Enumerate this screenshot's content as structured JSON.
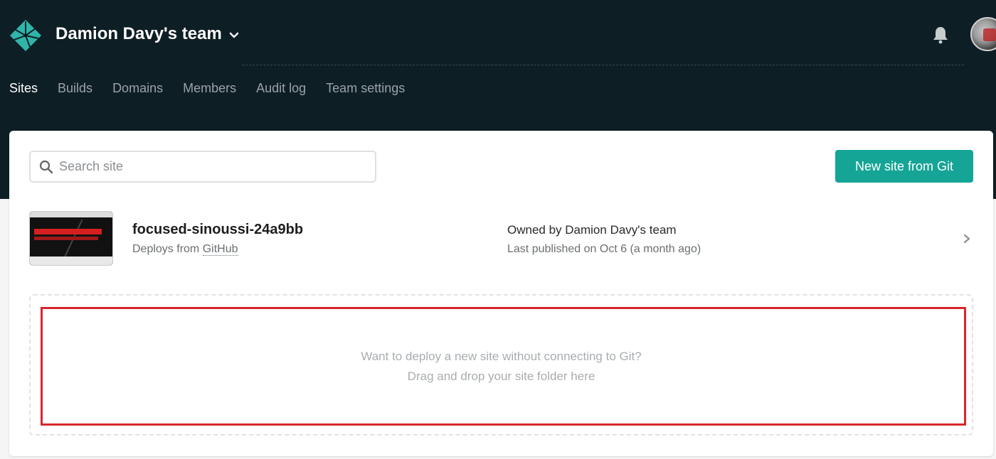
{
  "header": {
    "team_name": "Damion Davy's team",
    "icons": {
      "logo": "netlify-logo-icon",
      "team_chevron": "chevron-down-icon",
      "notifications": "bell-icon",
      "avatar": "user-avatar"
    }
  },
  "nav": {
    "tabs": [
      {
        "label": "Sites",
        "active": true
      },
      {
        "label": "Builds",
        "active": false
      },
      {
        "label": "Domains",
        "active": false
      },
      {
        "label": "Members",
        "active": false
      },
      {
        "label": "Audit log",
        "active": false
      },
      {
        "label": "Team settings",
        "active": false
      }
    ]
  },
  "search": {
    "placeholder": "Search site",
    "value": "",
    "icon": "search-icon"
  },
  "actions": {
    "new_site_label": "New site from Git"
  },
  "sites": [
    {
      "name": "focused-sinoussi-24a9bb",
      "deploys_prefix": "Deploys from ",
      "deploys_source": "GitHub",
      "owned_prefix": "Owned by ",
      "owner": "Damion Davy's team",
      "published": "Last published on Oct 6 (a month ago)"
    }
  ],
  "dropzone": {
    "line1": "Want to deploy a new site without connecting to Git?",
    "line2": "Drag and drop your site folder here"
  },
  "colors": {
    "header_bg": "#0e1e25",
    "accent": "#15a596",
    "highlight_border": "#d9262c",
    "page_bg": "#f5f5f5"
  }
}
